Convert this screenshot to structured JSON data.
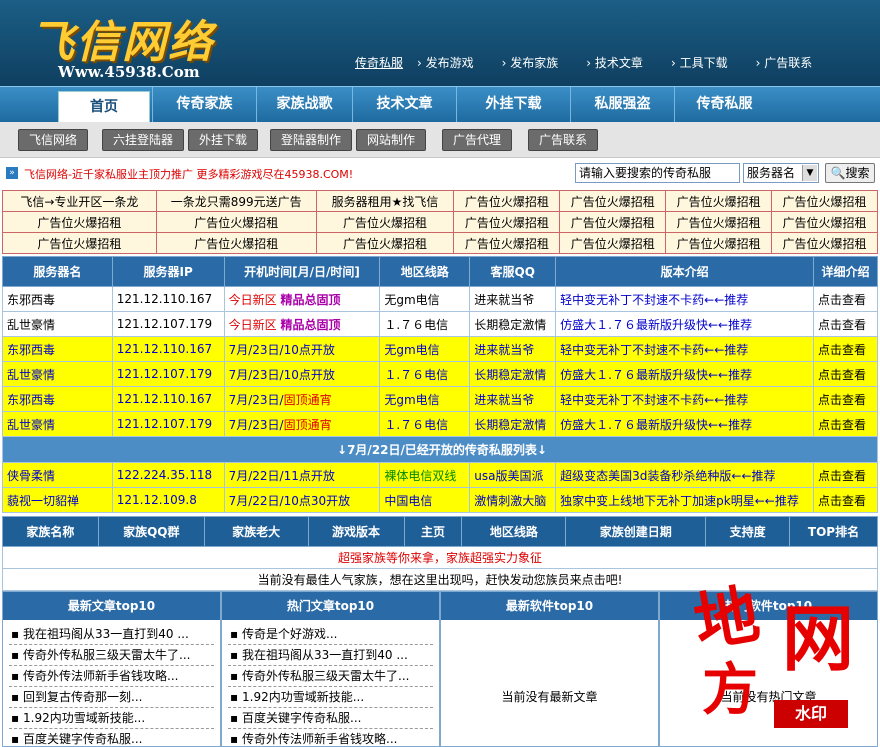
{
  "header": {
    "logo_text": "飞信网络",
    "logo_url": "Www.45938.Com",
    "top_links": [
      "传奇私服",
      "发布游戏",
      "发布家族",
      "技术文章",
      "工具下载",
      "广告联系"
    ]
  },
  "main_nav": [
    "首页",
    "传奇家族",
    "家族战歌",
    "技术文章",
    "外挂下载",
    "私服强盗",
    "传奇私服"
  ],
  "sub_nav": [
    "飞信网络",
    "六挂登陆器",
    "外挂下载",
    "登陆器制作",
    "网站制作",
    "广告代理",
    "广告联系"
  ],
  "search": {
    "promo": "飞信网络-近千家私服业主顶力推广 更多精彩游戏尽在45938.COM!",
    "input_value": "请输入要搜索的传奇私服",
    "select_value": "服务器名",
    "button_label": "搜索"
  },
  "ads": [
    [
      "飞信→专业开区一条龙",
      "一条龙只需899元送广告",
      "服务器租用★找飞信",
      "广告位火爆招租",
      "广告位火爆招租",
      "广告位火爆招租",
      "广告位火爆招租"
    ],
    [
      "广告位火爆招租",
      "广告位火爆招租",
      "广告位火爆招租",
      "广告位火爆招租",
      "广告位火爆招租",
      "广告位火爆招租",
      "广告位火爆招租"
    ],
    [
      "广告位火爆招租",
      "广告位火爆招租",
      "广告位火爆招租",
      "广告位火爆招租",
      "广告位火爆招租",
      "广告位火爆招租",
      "广告位火爆招租"
    ]
  ],
  "server_table": {
    "headers": [
      "服务器名",
      "服务器IP",
      "开机时间[月/日/时间]",
      "地区线路",
      "客服QQ",
      "版本介绍",
      "详细介绍"
    ],
    "rows": [
      {
        "name": "东邪西毒",
        "ip": "121.12.110.167",
        "time": "今日新区",
        "time_extra": "精品总固顶",
        "line": "无gm电信",
        "qq": "进来就当爷",
        "intro": "轻中变无补丁不封速不卡药←←推荐",
        "detail": "点击查看"
      },
      {
        "name": "乱世豪情",
        "ip": "121.12.107.179",
        "time": "今日新区",
        "time_extra": "精品总固顶",
        "line": "１.７６电信",
        "qq": "长期稳定激情",
        "intro": "仿盛大１.７６最新版升级快←←推荐",
        "detail": "点击查看"
      },
      {
        "name": "东邪西毒",
        "ip": "121.12.110.167",
        "time": "7月/23日/10点开放",
        "time_extra": "",
        "line": "无gm电信",
        "qq": "进来就当爷",
        "intro": "轻中变无补丁不封速不卡药←←推荐",
        "detail": "点击查看"
      },
      {
        "name": "乱世豪情",
        "ip": "121.12.107.179",
        "time": "7月/23日/10点开放",
        "time_extra": "",
        "line": "１.７６电信",
        "qq": "长期稳定激情",
        "intro": "仿盛大１.７６最新版升级快←←推荐",
        "detail": "点击查看"
      },
      {
        "name": "东邪西毒",
        "ip": "121.12.110.167",
        "time": "7月/23日/",
        "time_extra": "固顶通宵",
        "line": "无gm电信",
        "qq": "进来就当爷",
        "intro": "轻中变无补丁不封速不卡药←←推荐",
        "detail": "点击查看"
      },
      {
        "name": "乱世豪情",
        "ip": "121.12.107.179",
        "time": "7月/23日/",
        "time_extra": "固顶通宵",
        "line": "１.７６电信",
        "qq": "长期稳定激情",
        "intro": "仿盛大１.７６最新版升级快←←推荐",
        "detail": "点击查看"
      }
    ],
    "separator": "↓7月/22日/已经开放的传奇私服列表↓",
    "opened_rows": [
      {
        "name": "侠骨柔情",
        "ip": "122.224.35.118",
        "time": "7月/22日/11点开放",
        "line": "裸体电信双线",
        "qq": "usa版美国派",
        "intro": "超级变态美国3d装备秒杀绝种版←←推荐",
        "detail": "点击查看"
      },
      {
        "name": "藐视一切貂禅",
        "ip": "121.12.109.8",
        "time": "7月/22日/10点30开放",
        "line": "中国电信",
        "qq": "激情刺激大脑",
        "intro": "独家中变上线地下无补丁加速pk明星←←推荐",
        "detail": "点击查看"
      }
    ]
  },
  "family_table": {
    "headers": [
      "家族名称",
      "家族QQ群",
      "家族老大",
      "游戏版本",
      "主页",
      "地区线路",
      "家族创建日期",
      "支持度",
      "TOP排名"
    ],
    "slogan": "超强家族等你来拿，家族超强实力象征",
    "empty_text": "当前没有最佳人气家族，想在这里出现吗，赶快发动您族员来点击吧!"
  },
  "columns": [
    {
      "title": "最新文章top10",
      "items": [
        "我在祖玛阁从33一直打到40 ...",
        "传奇外传私服三级天雷太牛了...",
        "传奇外传法师新手省钱攻略...",
        "回到复古传奇那一刻...",
        "1.92内功雪域新技能...",
        "百度关键字传奇私服..."
      ]
    },
    {
      "title": "热门文章top10",
      "items": [
        "传奇是个好游戏...",
        "我在祖玛阁从33一直打到40 ...",
        "传奇外传私服三级天雷太牛了...",
        "1.92内功雪域新技能...",
        "百度关键字传奇私服...",
        "传奇外传法师新手省钱攻略..."
      ]
    },
    {
      "title": "最新软件top10",
      "empty": "当前没有最新文章"
    },
    {
      "title": "热门软件top10",
      "empty": "当前没有热门文章"
    }
  ],
  "watermark": {
    "char1": "地",
    "char2": "网",
    "char3": "方",
    "badge": "水印"
  }
}
